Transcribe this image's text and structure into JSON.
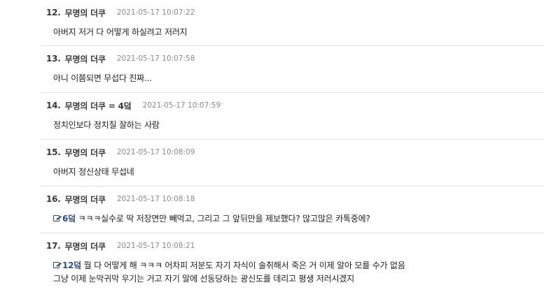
{
  "comments": [
    {
      "num": "12.",
      "author": "무명의 더쿠",
      "timestamp": "2021-05-17 10:07:22",
      "lines": [
        "아버지 저거 다 어떻게 하실려고 저러지"
      ]
    },
    {
      "num": "13.",
      "author": "무명의 더쿠",
      "timestamp": "2021-05-17 10:07:58",
      "lines": [
        "아니 이쯤되면 무섭다 진짜..."
      ]
    },
    {
      "num": "14.",
      "author": "무명의 더쿠 = 4덬",
      "timestamp": "2021-05-17 10:07:59",
      "lines": [
        "정치인보다 정치질 잘하는 사람"
      ]
    },
    {
      "num": "15.",
      "author": "무명의 더쿠",
      "timestamp": "2021-05-17 10:08:09",
      "lines": [
        "아버지 정신상태 무섭네"
      ]
    },
    {
      "num": "16.",
      "author": "무명의 더쿠",
      "timestamp": "2021-05-17 10:08:18",
      "anchor": "6덬",
      "lines": [
        "ㅋㅋㅋ실수로 딱 저장면만 빼먹고, 그리고 그 앞뒤만을 제보했다? 많고많은 카톡중에?"
      ]
    },
    {
      "num": "17.",
      "author": "무명의 더쿠",
      "timestamp": "2021-05-17 10:08:21",
      "anchor": "12덬",
      "lines": [
        "뭘 다 어떻게 해 ㅋㅋㅋ 어차피 저분도 자기 자식이 술취해서 죽은 거 이제 알아 모를 수가 없음",
        "그냥 이제 눈막귀막 우기는 거고 자기 말에 선동당하는 광신도를 데리고 평생 저러시겠지"
      ]
    }
  ],
  "icons": {
    "anchor": "reply-anchor-icon"
  }
}
